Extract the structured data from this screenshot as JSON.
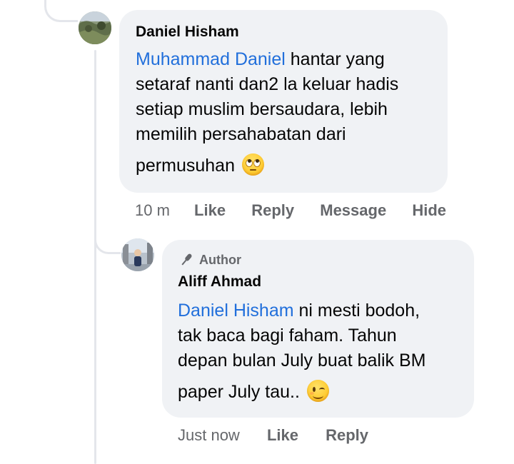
{
  "comment": {
    "author": "Daniel Hisham",
    "mention": "Muhammad Daniel",
    "text_lines": [
      " hantar yang",
      "setaraf nanti dan2 la keluar hadis",
      "setiap muslim bersaudara, lebih",
      "memilih persahabatan dari"
    ],
    "last_line": "permusuhan",
    "emoji_icon": "face-with-rolling-eyes-emoji",
    "actions": {
      "time": "10 m",
      "like": "Like",
      "reply": "Reply",
      "message": "Message",
      "hide": "Hide"
    }
  },
  "reply": {
    "badge": "Author",
    "badge_icon": "microphone-icon",
    "author": "Aliff Ahmad",
    "mention": "Daniel Hisham",
    "text_lines": [
      " ni mesti bodoh,",
      "tak baca bagi faham. Tahun",
      "depan bulan July buat balik BM"
    ],
    "last_line": "paper July tau..",
    "emoji_icon": "winking-face-emoji",
    "actions": {
      "time": "Just now",
      "like": "Like",
      "reply": "Reply"
    }
  },
  "colors": {
    "bubble": "#f0f2f5",
    "mention": "#216fdb",
    "secondary_text": "#65676b",
    "thread_line": "#e4e6eb"
  }
}
